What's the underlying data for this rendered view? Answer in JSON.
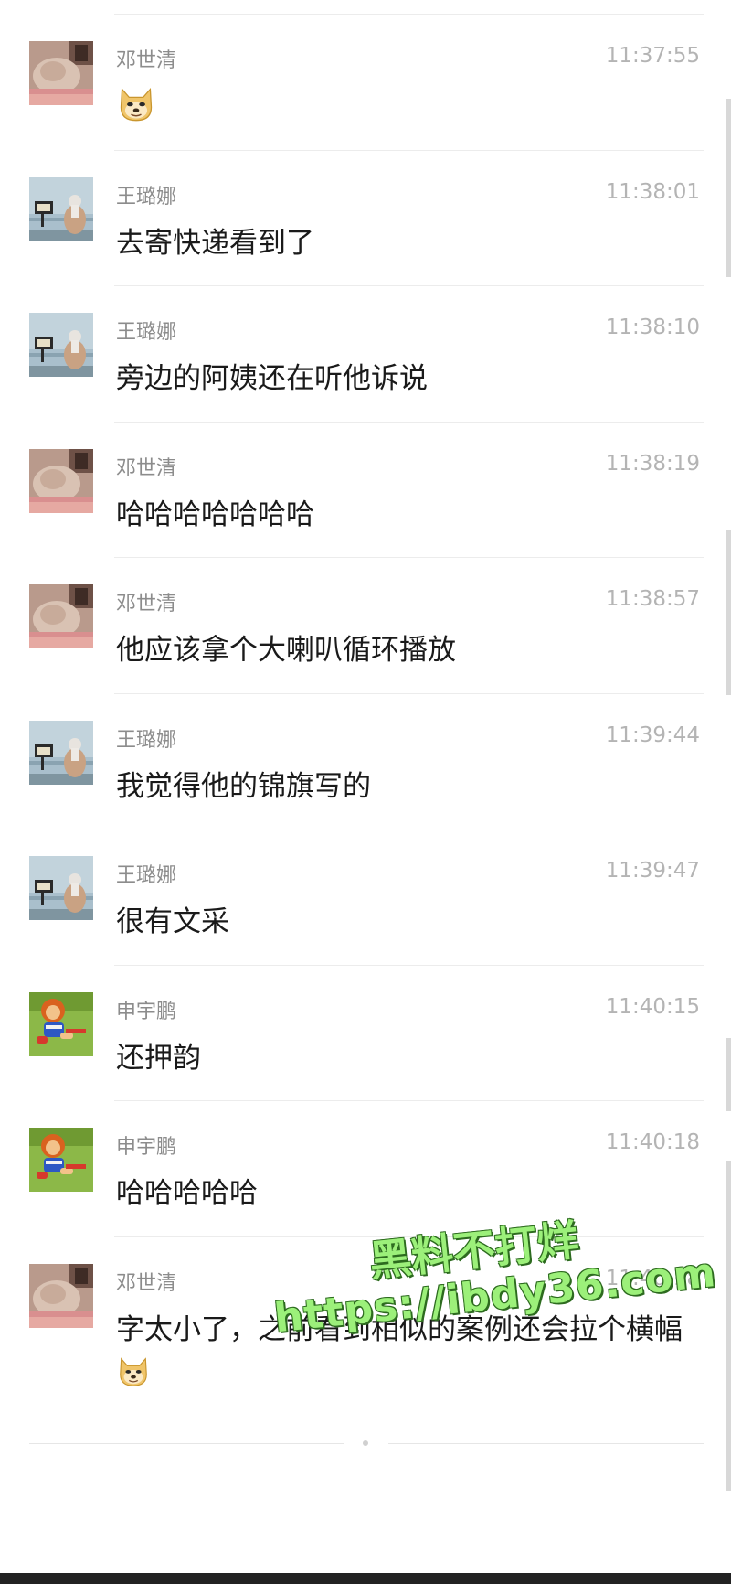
{
  "messages": [
    {
      "sender": "邓世清",
      "avatar": "cat-avatar",
      "time": "11:37:55",
      "text": "",
      "emoji": "doge"
    },
    {
      "sender": "王璐娜",
      "avatar": "seaside-avatar",
      "time": "11:38:01",
      "text": "去寄快递看到了"
    },
    {
      "sender": "王璐娜",
      "avatar": "seaside-avatar",
      "time": "11:38:10",
      "text": "旁边的阿姨还在听他诉说"
    },
    {
      "sender": "邓世清",
      "avatar": "cat-avatar",
      "time": "11:38:19",
      "text": "哈哈哈哈哈哈哈"
    },
    {
      "sender": "邓世清",
      "avatar": "cat-avatar",
      "time": "11:38:57",
      "text": "他应该拿个大喇叭循环播放"
    },
    {
      "sender": "王璐娜",
      "avatar": "seaside-avatar",
      "time": "11:39:44",
      "text": "我觉得他的锦旗写的"
    },
    {
      "sender": "王璐娜",
      "avatar": "seaside-avatar",
      "time": "11:39:47",
      "text": "很有文采"
    },
    {
      "sender": "申宇鹏",
      "avatar": "cartoon-avatar",
      "time": "11:40:15",
      "text": "还押韵"
    },
    {
      "sender": "申宇鹏",
      "avatar": "cartoon-avatar",
      "time": "11:40:18",
      "text": "哈哈哈哈哈"
    },
    {
      "sender": "邓世清",
      "avatar": "cat-avatar",
      "time": "11:40:18",
      "text": "字太小了，之前看到相似的案例还会拉个横幅",
      "emoji": "doge"
    }
  ],
  "watermark": {
    "line1": "黑料不打烊",
    "line2": "https://ibdy36.com"
  },
  "colors": {
    "name": "#8c8c8c",
    "time": "#b4b4b4",
    "text": "#1a1a1a",
    "divider": "#ececec",
    "watermark": "#9cf07a"
  }
}
